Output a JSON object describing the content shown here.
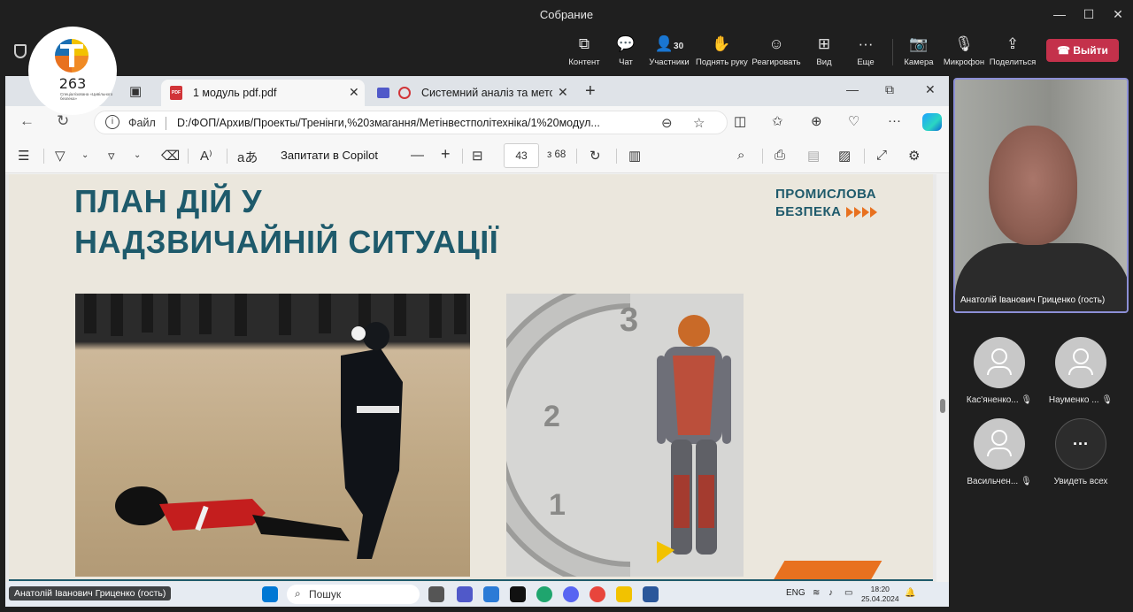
{
  "window": {
    "title": "Собрание",
    "minimize": "—",
    "maximize": "☐",
    "close": "✕"
  },
  "toolbar": {
    "items": [
      {
        "label": "Контент",
        "icon": "share-screen-icon",
        "glyph": "⧉"
      },
      {
        "label": "Чат",
        "icon": "chat-icon",
        "glyph": "💬"
      },
      {
        "label": "Участники",
        "icon": "people-icon",
        "glyph": "👤",
        "count": "30"
      },
      {
        "label": "Поднять руку",
        "icon": "raise-hand-icon",
        "glyph": "✋"
      },
      {
        "label": "Реагировать",
        "icon": "react-icon",
        "glyph": "☺"
      },
      {
        "label": "Вид",
        "icon": "view-icon",
        "glyph": "⊞"
      },
      {
        "label": "Еще",
        "icon": "more-icon",
        "glyph": "···"
      },
      {
        "label": "Камера",
        "icon": "camera-off-icon",
        "glyph": "📷"
      },
      {
        "label": "Микрофон",
        "icon": "mic-off-icon",
        "glyph": "🎙"
      },
      {
        "label": "Поделиться",
        "icon": "share-icon",
        "glyph": "⇪"
      }
    ],
    "leave_label": "Выйти",
    "accent": "#c4314b"
  },
  "logo": {
    "number": "263",
    "subtitle": "Спеціалізована «Цивільного безпека»"
  },
  "browser": {
    "tabs": [
      {
        "label": "1 модуль pdf.pdf",
        "active": true
      },
      {
        "label": "Системний аналіз та метод",
        "active": false
      }
    ],
    "new_tab": "+",
    "address": {
      "scheme_label": "Файл",
      "url": "D:/ФОП/Архив/Проекты/Тренінги,%20змагання/Метінвестполітехніка/1%20модул..."
    }
  },
  "pdf": {
    "ask_copilot": "Запитати в Copilot",
    "page_current": "43",
    "page_total": "з 68",
    "zoom_minus": "—",
    "zoom_plus": "+"
  },
  "slide": {
    "title_line1": "ПЛАН ДІЙ У",
    "title_line2": "НАДЗВИЧАЙНІЙ СИТУАЦІЇ",
    "brand_line1": "ПРОМИСЛОВА",
    "brand_line2": "БЕЗПЕКА",
    "title_color": "#1e5a6b",
    "accent_color": "#e8711f",
    "diagram_numbers": [
      "3",
      "2",
      "1"
    ]
  },
  "taskbar": {
    "presenter_label": "Анатолій Іванович Гриценко (гость)",
    "search_placeholder": "Пошук",
    "lang": "ENG",
    "time": "18:20",
    "date": "25.04.2024"
  },
  "participants": {
    "video_name": "Анатолій Іванович Гриценко (гость)",
    "tiles": [
      {
        "name": "Кас'яненко..."
      },
      {
        "name": "Науменко ..."
      },
      {
        "name": "Васильчен..."
      },
      {
        "name": "Увидеть всех"
      }
    ]
  }
}
